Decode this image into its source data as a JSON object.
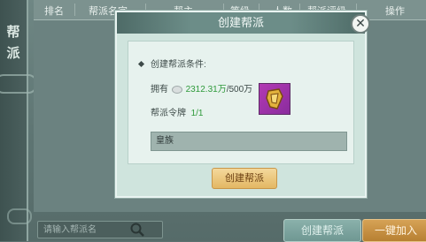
{
  "side_panel": {
    "title": "帮派"
  },
  "table": {
    "headers": [
      "排名",
      "帮派名字",
      "帮主",
      "等级",
      "人数",
      "帮派评级",
      "操作"
    ]
  },
  "bottom": {
    "search_placeholder": "请输入帮派名",
    "create_button": "创建帮派",
    "join_button": "一键加入"
  },
  "modal": {
    "title": "创建帮派",
    "conditions_label": "创建帮派条件:",
    "own_label": "拥有",
    "own_amount": "2312.31万",
    "own_required": "/500万",
    "token_label": "帮派令牌",
    "token_count": "1/1",
    "clan_name_value": "皇族",
    "create_button": "创建帮派",
    "close_symbol": "✕"
  },
  "colors": {
    "accent_green": "#2f9a3b",
    "item_purple": "#b23ab3",
    "gold_button": "#e3b763"
  }
}
